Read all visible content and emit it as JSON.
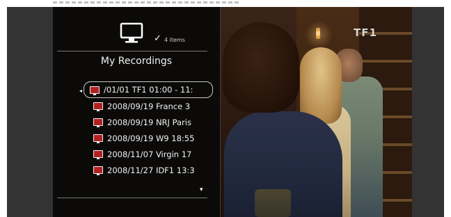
{
  "channel_logo": "TF1",
  "panel": {
    "header_icon": "tv-icon",
    "count_check": "✓",
    "count_label": "4 items",
    "title": "My Recordings",
    "selector_arrow": "◂",
    "scroll_indicator": "▾",
    "items": [
      {
        "label": "/01/01 TF1 01:00 - 11:",
        "selected": true
      },
      {
        "label": "2008/09/19 France 3",
        "selected": false
      },
      {
        "label": "2008/09/19 NRJ Paris",
        "selected": false
      },
      {
        "label": "2008/09/19 W9 18:55",
        "selected": false
      },
      {
        "label": "2008/11/07 Virgin 17",
        "selected": false
      },
      {
        "label": "2008/11/27 IDF1 13:3",
        "selected": false
      }
    ]
  },
  "colors": {
    "panel_background": "#0a0a0a",
    "record_icon": "#b32020",
    "text": "#f2f2f2",
    "side_bars": "#333333"
  }
}
